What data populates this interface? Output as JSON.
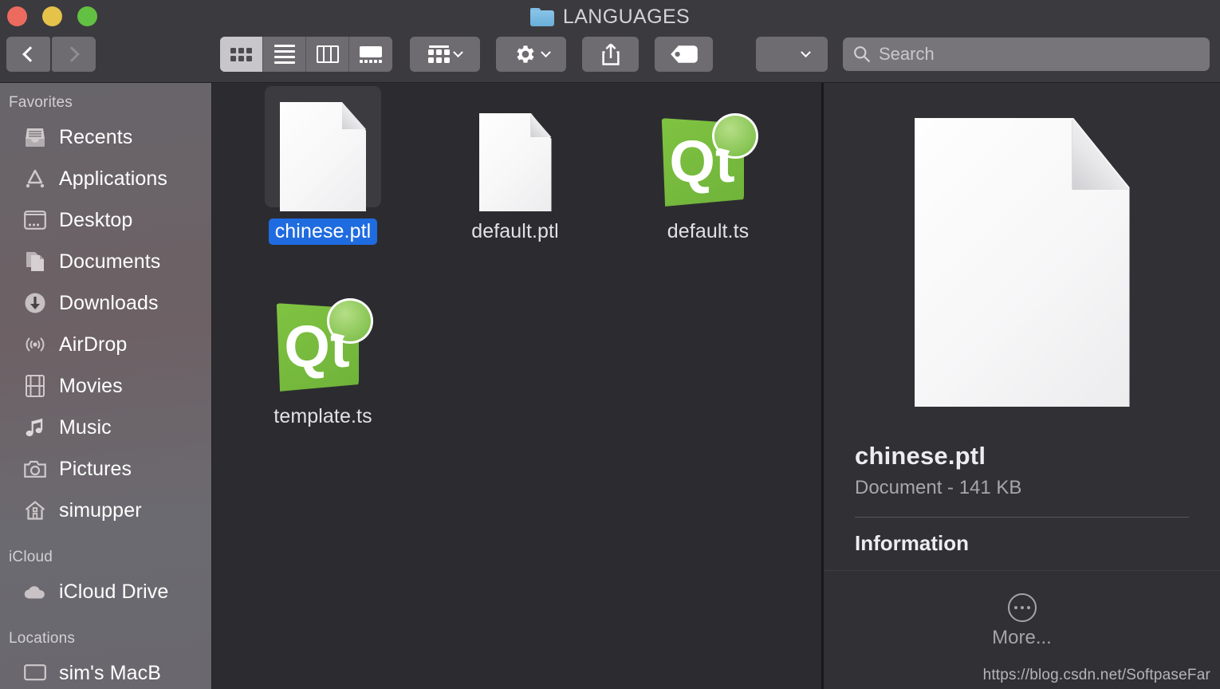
{
  "window": {
    "title": "LANGUAGES",
    "folder_icon": "folder-icon",
    "traffic_lights": [
      {
        "name": "close",
        "color": "#ec6a5e"
      },
      {
        "name": "minimize",
        "color": "#e5c249"
      },
      {
        "name": "maximize",
        "color": "#62c142"
      }
    ]
  },
  "toolbar": {
    "back_icon": "chevron-left-icon",
    "forward_icon": "chevron-right-icon",
    "view_modes": [
      {
        "name": "icon-view",
        "icon": "grid-icon",
        "active": true
      },
      {
        "name": "list-view",
        "icon": "list-icon",
        "active": false
      },
      {
        "name": "column-view",
        "icon": "columns-icon",
        "active": false
      },
      {
        "name": "gallery-view",
        "icon": "gallery-icon",
        "active": false
      }
    ],
    "arrange_icon": "arrange-grid-icon",
    "gear_icon": "gear-icon",
    "share_icon": "share-icon",
    "tag_icon": "tag-icon",
    "dropdown_icon": "chevron-down-icon",
    "search": {
      "placeholder": "Search",
      "value": "",
      "icon": "search-icon"
    }
  },
  "sidebar": {
    "sections": [
      {
        "heading": "Favorites",
        "items": [
          {
            "label": "Recents",
            "icon": "recents-icon"
          },
          {
            "label": "Applications",
            "icon": "applications-icon"
          },
          {
            "label": "Desktop",
            "icon": "desktop-icon"
          },
          {
            "label": "Documents",
            "icon": "documents-icon"
          },
          {
            "label": "Downloads",
            "icon": "downloads-icon"
          },
          {
            "label": "AirDrop",
            "icon": "airdrop-icon"
          },
          {
            "label": "Movies",
            "icon": "movies-icon"
          },
          {
            "label": "Music",
            "icon": "music-icon"
          },
          {
            "label": "Pictures",
            "icon": "pictures-icon"
          },
          {
            "label": "simupper",
            "icon": "home-icon"
          }
        ]
      },
      {
        "heading": "iCloud",
        "items": [
          {
            "label": "iCloud Drive",
            "icon": "cloud-icon"
          }
        ]
      },
      {
        "heading": "Locations",
        "items": [
          {
            "label": "sim's MacB",
            "icon": "computer-icon"
          }
        ]
      }
    ]
  },
  "files": [
    {
      "name": "chinese.ptl",
      "icon": "document-icon",
      "selected": true
    },
    {
      "name": "default.ptl",
      "icon": "document-icon",
      "selected": false
    },
    {
      "name": "default.ts",
      "icon": "qt-icon",
      "selected": false
    },
    {
      "name": "template.ts",
      "icon": "qt-icon",
      "selected": false
    }
  ],
  "preview": {
    "icon": "document-icon",
    "name": "chinese.ptl",
    "meta": "Document - 141 KB",
    "section_heading": "Information",
    "more_label": "More...",
    "more_icon": "ellipsis-circle-icon"
  },
  "watermark": "https://blog.csdn.net/SoftpaseFar",
  "colors": {
    "selection_blue": "#1f6be0",
    "qt_green": "#80c342",
    "toolbar_bg": "#3b3a3e",
    "content_bg": "#2c2c30",
    "preview_bg": "#303035"
  }
}
